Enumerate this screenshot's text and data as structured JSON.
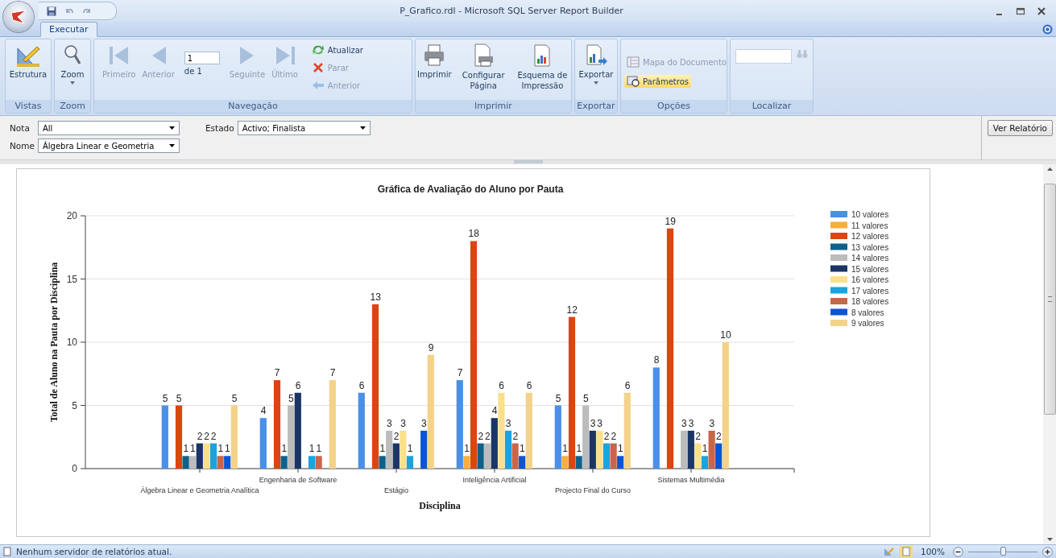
{
  "window": {
    "title": "P_Grafico.rdl - Microsoft SQL Server Report Builder"
  },
  "tabs": [
    {
      "label": "Executar",
      "selected": true
    }
  ],
  "ribbon": {
    "groups": [
      {
        "label": "Vistas",
        "items": [
          {
            "label": "Estrutura",
            "disabled": false
          }
        ]
      },
      {
        "label": "Zoom",
        "items": [
          {
            "label": "Zoom",
            "disabled": false
          }
        ]
      },
      {
        "label": "Navegação",
        "page_field": {
          "value": "1"
        },
        "page_of": "de 1",
        "items": [
          {
            "label": "Primeiro",
            "disabled": true
          },
          {
            "label": "Anterior",
            "disabled": true
          },
          {
            "label": "Seguinte",
            "disabled": true
          },
          {
            "label": "Último",
            "disabled": true
          }
        ],
        "small_items": [
          {
            "label": "Atualizar",
            "disabled": false
          },
          {
            "label": "Parar",
            "disabled": true
          },
          {
            "label": "Anterior",
            "disabled": true
          }
        ]
      },
      {
        "label": "Imprimir",
        "items": [
          {
            "label": "Imprimir",
            "disabled": false
          },
          {
            "label": "Configurar Página",
            "disabled": false
          },
          {
            "label": "Esquema de Impressão",
            "disabled": false
          }
        ]
      },
      {
        "label": "Exportar",
        "items": [
          {
            "label": "Exportar",
            "disabled": false
          }
        ]
      },
      {
        "label": "Opções",
        "items": [
          {
            "label": "Mapa do Documento",
            "disabled": true,
            "selected": false
          },
          {
            "label": "Parâmetros",
            "disabled": false,
            "selected": true
          }
        ]
      },
      {
        "label": "Localizar"
      }
    ]
  },
  "parameters": {
    "fields": [
      {
        "label": "Nota",
        "value": "All"
      },
      {
        "label": "Estado",
        "value": "Activo; Finalista"
      },
      {
        "label": "Nome",
        "value": "Álgebra Linear e Geometria"
      }
    ],
    "view_button": "Ver Relatório"
  },
  "report": {
    "chart_data": {
      "type": "bar",
      "title": "Gráfica de Avaliação do Aluno por Pauta",
      "xlabel": "Disciplina",
      "ylabel": "Total de Aluno na Pauta por Disciplina",
      "categories": [
        "Álgebra Linear e Geometria Analítica",
        "Engenharia de Software",
        "Estágio",
        "Inteligência Artificial",
        "Projecto Final do Curso",
        "Sistemas Multimédia"
      ],
      "series": [
        {
          "name": "10 valores",
          "color": "#4a8fe8",
          "values": [
            5,
            4,
            6,
            7,
            5,
            8
          ]
        },
        {
          "name": "11 valores",
          "color": "#f8ae3c",
          "values": [
            null,
            null,
            null,
            1,
            1,
            null
          ]
        },
        {
          "name": "12 valores",
          "color": "#dc4510",
          "values": [
            5,
            7,
            13,
            18,
            12,
            19
          ]
        },
        {
          "name": "13 valores",
          "color": "#0e6189",
          "values": [
            1,
            1,
            1,
            2,
            1,
            null
          ]
        },
        {
          "name": "14 valores",
          "color": "#bcbcbc",
          "values": [
            1,
            5,
            3,
            2,
            5,
            3
          ]
        },
        {
          "name": "15 valores",
          "color": "#1a3566",
          "values": [
            2,
            6,
            2,
            4,
            3,
            3
          ]
        },
        {
          "name": "16 valores",
          "color": "#fbe08a",
          "values": [
            2,
            null,
            3,
            6,
            3,
            2
          ]
        },
        {
          "name": "17 valores",
          "color": "#1ba3df",
          "values": [
            2,
            1,
            1,
            3,
            2,
            1
          ]
        },
        {
          "name": "18 valores",
          "color": "#c9664a",
          "values": [
            1,
            1,
            null,
            2,
            2,
            3
          ]
        },
        {
          "name": "8 valores",
          "color": "#0b55d3",
          "values": [
            1,
            null,
            3,
            1,
            1,
            2
          ]
        },
        {
          "name": "9 valores",
          "color": "#f3d28a",
          "values": [
            5,
            7,
            9,
            6,
            6,
            10
          ]
        }
      ],
      "ylim": [
        0,
        20
      ],
      "yticks": [
        0,
        5,
        10,
        15,
        20
      ],
      "data_labels": true,
      "grid": true,
      "legend": true
    }
  },
  "status_bar": {
    "message": "Nenhum servidor de relatórios atual.",
    "zoom": "100%",
    "zoom_slider": {
      "level": 0.5
    }
  }
}
